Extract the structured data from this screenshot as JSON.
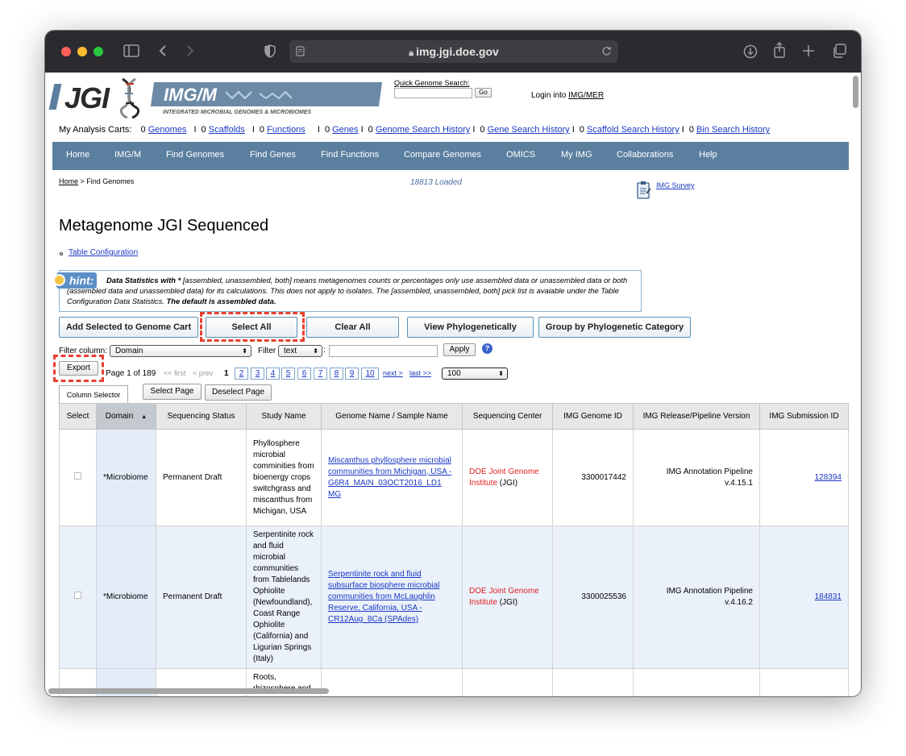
{
  "browser": {
    "url": "img.jgi.doe.gov",
    "colors": {
      "close": "#fe5f57",
      "minimize": "#febc2e",
      "zoom": "#28c840"
    }
  },
  "header": {
    "jgi_logo": "JGI",
    "imgm_logo": "IMG/M",
    "imgm_subtitle": "INTEGRATED MICROBIAL GENOMES & MICROBIOMES",
    "quick_search_label": "Quick Genome Search:",
    "go_button": "Go",
    "login_prefix": "Login into ",
    "login_link": "IMG/MER"
  },
  "carts": {
    "label": "My Analysis Carts:",
    "items": [
      {
        "count": "0",
        "name": "Genomes"
      },
      {
        "count": "0",
        "name": "Scaffolds"
      },
      {
        "count": "0",
        "name": "Functions"
      },
      {
        "count": "0",
        "name": "Genes"
      },
      {
        "count": "0",
        "name": "Genome Search History"
      },
      {
        "count": "0",
        "name": "Gene Search History"
      },
      {
        "count": "0",
        "name": "Scaffold Search History"
      },
      {
        "count": "0",
        "name": "Bin Search History"
      }
    ]
  },
  "nav": [
    "Home",
    "IMG/M",
    "Find Genomes",
    "Find Genes",
    "Find Functions",
    "Compare Genomes",
    "OMICS",
    "My IMG",
    "Collaborations",
    "Help"
  ],
  "breadcrumb": {
    "home": "Home",
    "sep": " > ",
    "current": "Find Genomes"
  },
  "loaded_status": "18813 Loaded",
  "survey_link": "IMG Survey",
  "page_title": "Metagenome JGI Sequenced",
  "table_config_link": "Table Configuration",
  "hint": {
    "badge": "hint:",
    "bold_lead": "Data Statistics with *",
    "text": " [assembled, unassembled, both] means metagenomes counts or percentages only use assembled data or unassembled data or both (assembled data and unassembled data) for its calculations. This does not apply to isolates. The [assembled, unassembled, both] pick list is avaiable under the Table Configuration Data Statistics. ",
    "bold_tail": "The default is assembled data."
  },
  "actions": {
    "add_to_cart": "Add Selected to Genome Cart",
    "select_all": "Select All",
    "clear_all": "Clear All",
    "view_phylo": "View Phylogenetically",
    "group_phylo": "Group by Phylogenetic Category"
  },
  "filter": {
    "column_label": "Filter column:",
    "column_value": "Domain",
    "filter_label": "Filter",
    "type_value": "text",
    "colon": ":",
    "apply": "Apply",
    "help_icon": "?"
  },
  "export_button": "Export",
  "pager": {
    "summary": "Page 1 of 189",
    "first": "<< first",
    "prev": "< prev",
    "current": "1",
    "pages": [
      "2",
      "3",
      "4",
      "5",
      "6",
      "7",
      "8",
      "9",
      "10"
    ],
    "next": "next >",
    "last": "last >>",
    "page_size": "100"
  },
  "table_buttons": {
    "column_selector": "Column Selector",
    "select_page": "Select Page",
    "deselect_page": "Deselect Page"
  },
  "table": {
    "headers": [
      "Select",
      "Domain",
      "Sequencing Status",
      "Study Name",
      "Genome Name / Sample Name",
      "Sequencing Center",
      "IMG Genome ID",
      "IMG Release/Pipeline Version",
      "IMG Submission ID"
    ],
    "rows": [
      {
        "domain": "*Microbiome",
        "status": "Permanent Draft",
        "study": "Phyllosphere microbial comminities from bioenergy crops switchgrass and miscanthus from Michigan, USA",
        "genome": "Miscanthus phyllosphere microbial communities from Michigan, USA - G6R4_MAIN_03OCT2016_LD1 MG",
        "center_red": "DOE Joint Genome Institute",
        "center_tail": " (JGI)",
        "genome_id": "3300017442",
        "pipeline": "IMG Annotation Pipeline v.4.15.1",
        "submission": "128394"
      },
      {
        "domain": "*Microbiome",
        "status": "Permanent Draft",
        "study": "Serpentinite rock and fluid microbial communities from Tablelands Ophiolite (Newfoundland), Coast Range Ophiolite (California) and Ligurian Springs (Italy)",
        "genome": "Serpentinite rock and fluid subsurface biosphere microbial communities from McLaughlin Reserve, California, USA - CR12Aug_8Ca (SPAdes)",
        "center_red": "DOE Joint Genome Institute",
        "center_tail": " (JGI)",
        "genome_id": "3300025536",
        "pipeline": "IMG Annotation Pipeline v.4.16.2",
        "submission": "184831"
      },
      {
        "study": "Roots, rhizosphere and"
      }
    ]
  }
}
